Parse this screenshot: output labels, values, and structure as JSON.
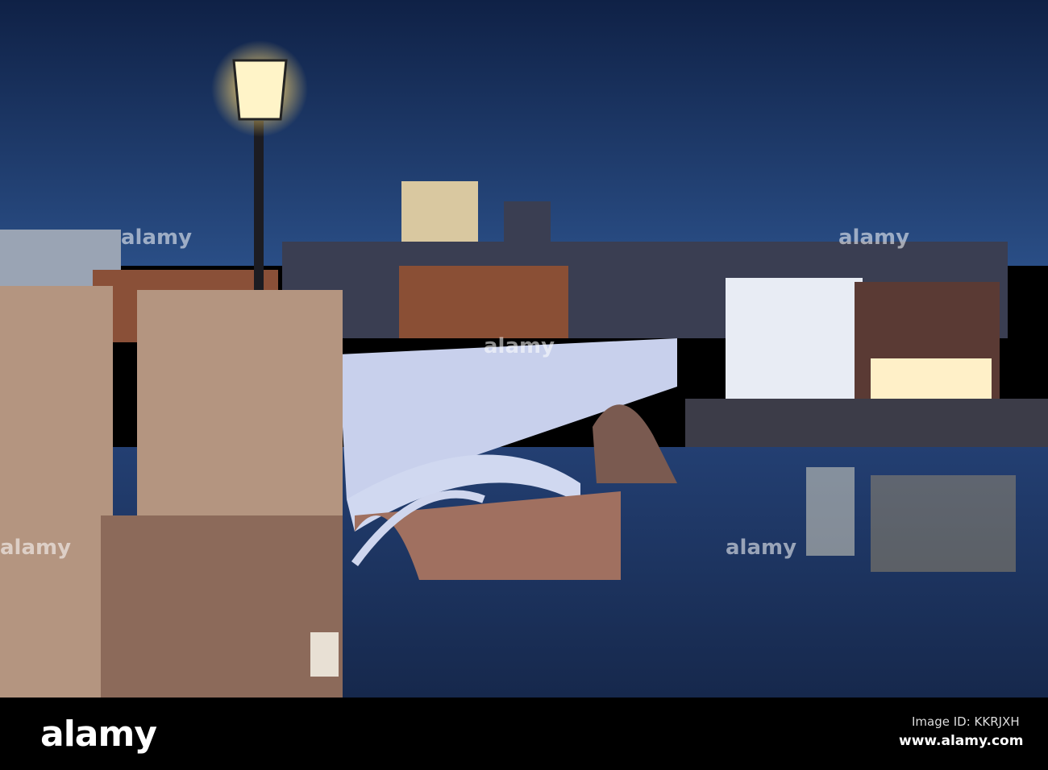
{
  "watermark": {
    "text": "alamy"
  },
  "footer": {
    "logo": "alamy",
    "image_id": "Image ID: KKRJXH",
    "url": "www.alamy.com"
  },
  "colors": {
    "sky": "#1b3a6b",
    "water": "#1a2f5c",
    "stone": "#b49580",
    "lamp": "#ffe9a8"
  }
}
